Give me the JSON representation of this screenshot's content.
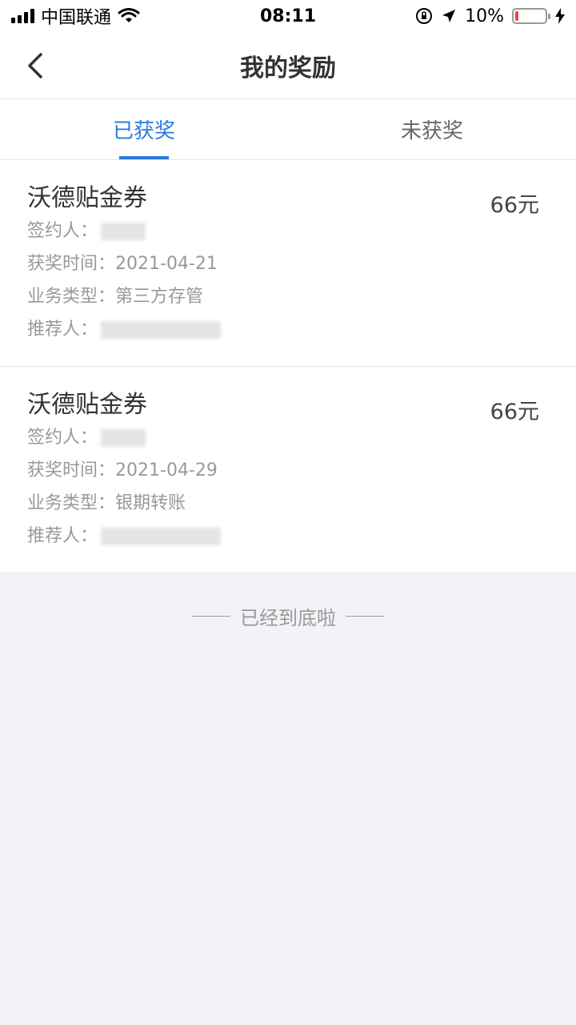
{
  "status_bar": {
    "carrier": "中国联通",
    "time": "08:11",
    "battery": "10%",
    "battery_level": 0.1
  },
  "header": {
    "title": "我的奖励"
  },
  "tabs": [
    {
      "label": "已获奖",
      "active": true
    },
    {
      "label": "未获奖",
      "active": false
    }
  ],
  "rewards": [
    {
      "title": "沃德贴金券",
      "amount": "66元",
      "signer_label": "签约人：",
      "date_label": "获奖时间：",
      "date": "2021-04-21",
      "type_label": "业务类型：",
      "type": "第三方存管",
      "referrer_label": "推荐人："
    },
    {
      "title": "沃德贴金券",
      "amount": "66元",
      "signer_label": "签约人：",
      "date_label": "获奖时间：",
      "date": "2021-04-29",
      "type_label": "业务类型：",
      "type": "银期转账",
      "referrer_label": "推荐人："
    }
  ],
  "footer": {
    "text": "已经到底啦"
  },
  "colors": {
    "accent": "#2a7cdb",
    "background": "#f2f3f7",
    "battery_low": "#e5493a"
  }
}
